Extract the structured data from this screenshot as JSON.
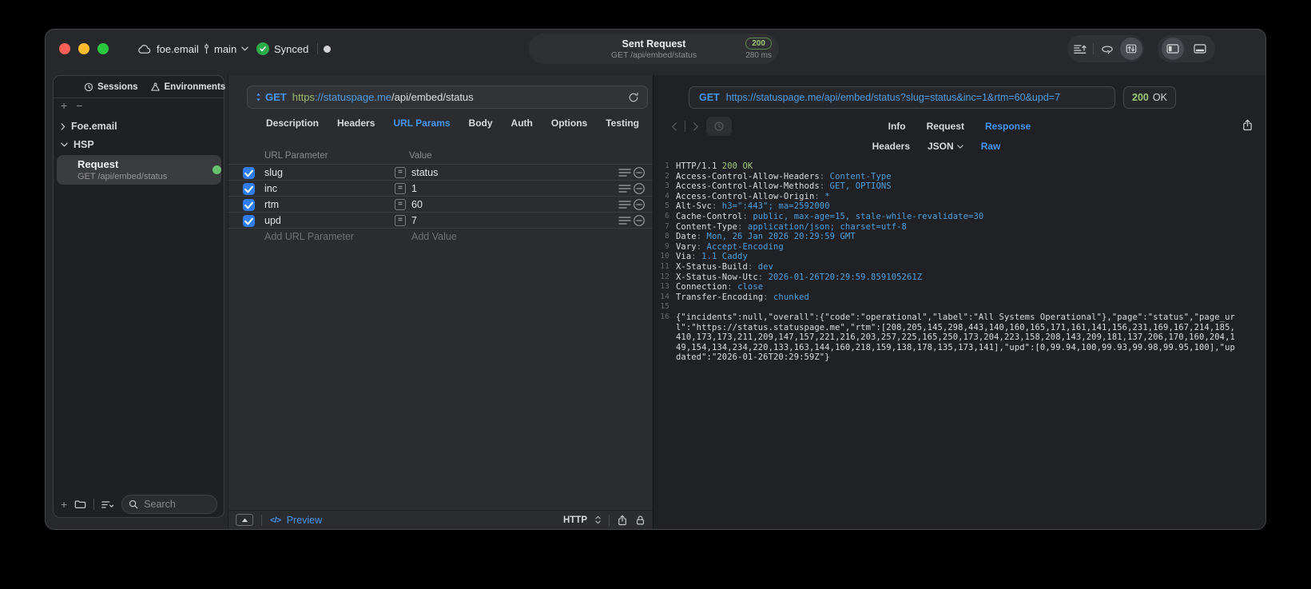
{
  "colors": {
    "blue": "#4596f7",
    "code-blue": "#4da0dd",
    "status-green": "#9ec878",
    "synced-green": "#2cab49",
    "dot-green": "#68c16d",
    "checkbox-blue": "#2f7df0",
    "traffic-red": "#ff5f57",
    "traffic-yellow": "#febc2e",
    "traffic-green": "#2ac840"
  },
  "titlebar": {
    "project_name": "foe.email",
    "branch_name": "main",
    "sync_label": "Synced",
    "request_summary": {
      "title": "Sent Request",
      "subtitle": "GET /api/embed/status",
      "status_code": "200",
      "duration": "280 ms"
    }
  },
  "sidebar": {
    "tabs": [
      {
        "label": "Sessions"
      },
      {
        "label": "Environments"
      }
    ],
    "tree": [
      {
        "label": "Foe.email"
      },
      {
        "label": "HSP"
      }
    ],
    "request_item": {
      "title": "Request",
      "subtitle": "GET /api/embed/status"
    },
    "search_placeholder": "Search"
  },
  "request_editor": {
    "method": "GET",
    "url": {
      "scheme": "https",
      "host": "://statuspage.me",
      "path": "/api/embed/status"
    },
    "tabs": [
      "Description",
      "Headers",
      "URL Params",
      "Body",
      "Auth",
      "Options",
      "Testing"
    ],
    "active_tab": "URL Params",
    "params": {
      "columns": [
        "URL Parameter",
        "Value"
      ],
      "rows": [
        {
          "enabled": true,
          "name": "slug",
          "value": "status"
        },
        {
          "enabled": true,
          "name": "inc",
          "value": "1"
        },
        {
          "enabled": true,
          "name": "rtm",
          "value": "60"
        },
        {
          "enabled": true,
          "name": "upd",
          "value": "7"
        }
      ],
      "add_name_placeholder": "Add URL Parameter",
      "add_value_placeholder": "Add Value"
    },
    "footer": {
      "code_glyph": "</>",
      "preview_label": "Preview",
      "protocol_label": "HTTP"
    }
  },
  "response_viewer": {
    "method": "GET",
    "url": "https://statuspage.me/api/embed/status?slug=status&inc=1&rtm=60&upd=7",
    "status_code": "200",
    "status_text": "OK",
    "tabs": [
      "Info",
      "Request",
      "Response"
    ],
    "active_tab": "Response",
    "view_tabs": [
      "Headers",
      "JSON",
      "Raw"
    ],
    "active_view_tab": "Raw",
    "code_lines": [
      {
        "n": "1",
        "seg": [
          [
            "w",
            "HTTP/1.1 "
          ],
          [
            "g",
            "200 OK"
          ]
        ]
      },
      {
        "n": "2",
        "seg": [
          [
            "w",
            "Access-Control-Allow-Headers"
          ],
          [
            "d",
            ": "
          ],
          [
            "b",
            "Content-Type"
          ]
        ]
      },
      {
        "n": "3",
        "seg": [
          [
            "w",
            "Access-Control-Allow-Methods"
          ],
          [
            "d",
            ": "
          ],
          [
            "b",
            "GET, OPTIONS"
          ]
        ]
      },
      {
        "n": "4",
        "seg": [
          [
            "w",
            "Access-Control-Allow-Origin"
          ],
          [
            "d",
            ": "
          ],
          [
            "b",
            "*"
          ]
        ]
      },
      {
        "n": "5",
        "seg": [
          [
            "w",
            "Alt-Svc"
          ],
          [
            "d",
            ": "
          ],
          [
            "b",
            "h3=\":443\"; ma=2592000"
          ]
        ]
      },
      {
        "n": "6",
        "seg": [
          [
            "w",
            "Cache-Control"
          ],
          [
            "d",
            ": "
          ],
          [
            "b",
            "public, max-age=15, stale-while-revalidate=30"
          ]
        ]
      },
      {
        "n": "7",
        "seg": [
          [
            "w",
            "Content-Type"
          ],
          [
            "d",
            ": "
          ],
          [
            "b",
            "application/json; charset=utf-8"
          ]
        ]
      },
      {
        "n": "8",
        "seg": [
          [
            "w",
            "Date"
          ],
          [
            "d",
            ": "
          ],
          [
            "b",
            "Mon, 26 Jan 2026 20:29:59 GMT"
          ]
        ]
      },
      {
        "n": "9",
        "seg": [
          [
            "w",
            "Vary"
          ],
          [
            "d",
            ": "
          ],
          [
            "b",
            "Accept-Encoding"
          ]
        ]
      },
      {
        "n": "10",
        "seg": [
          [
            "w",
            "Via"
          ],
          [
            "d",
            ": "
          ],
          [
            "b",
            "1.1 Caddy"
          ]
        ]
      },
      {
        "n": "11",
        "seg": [
          [
            "w",
            "X-Status-Build"
          ],
          [
            "d",
            ": "
          ],
          [
            "b",
            "dev"
          ]
        ]
      },
      {
        "n": "12",
        "seg": [
          [
            "w",
            "X-Status-Now-Utc"
          ],
          [
            "d",
            ": "
          ],
          [
            "b",
            "2026-01-26T20:29:59.859105261Z"
          ]
        ]
      },
      {
        "n": "13",
        "seg": [
          [
            "w",
            "Connection"
          ],
          [
            "d",
            ": "
          ],
          [
            "b",
            "close"
          ]
        ]
      },
      {
        "n": "14",
        "seg": [
          [
            "w",
            "Transfer-Encoding"
          ],
          [
            "d",
            ": "
          ],
          [
            "b",
            "chunked"
          ]
        ]
      },
      {
        "n": "15",
        "seg": []
      },
      {
        "n": "16",
        "seg": [
          [
            "w",
            "{\"incidents\":null,\"overall\":{\"code\":\"operational\",\"label\":\"All Systems Operational\"},\"page\":\"status\",\"page_url\":\"https://status.statuspage.me\",\"rtm\":[208,205,145,298,443,140,160,165,171,161,141,156,231,169,167,214,185,410,173,173,211,209,147,157,221,216,203,257,225,165,250,173,204,223,158,208,143,209,181,137,206,170,160,204,149,154,134,234,220,133,163,144,160,218,159,138,178,135,173,141],\"upd\":[0,99.94,100,99.93,99.98,99.95,100],\"updated\":\"2026-01-26T20:29:59Z\"}"
          ]
        ]
      }
    ]
  }
}
